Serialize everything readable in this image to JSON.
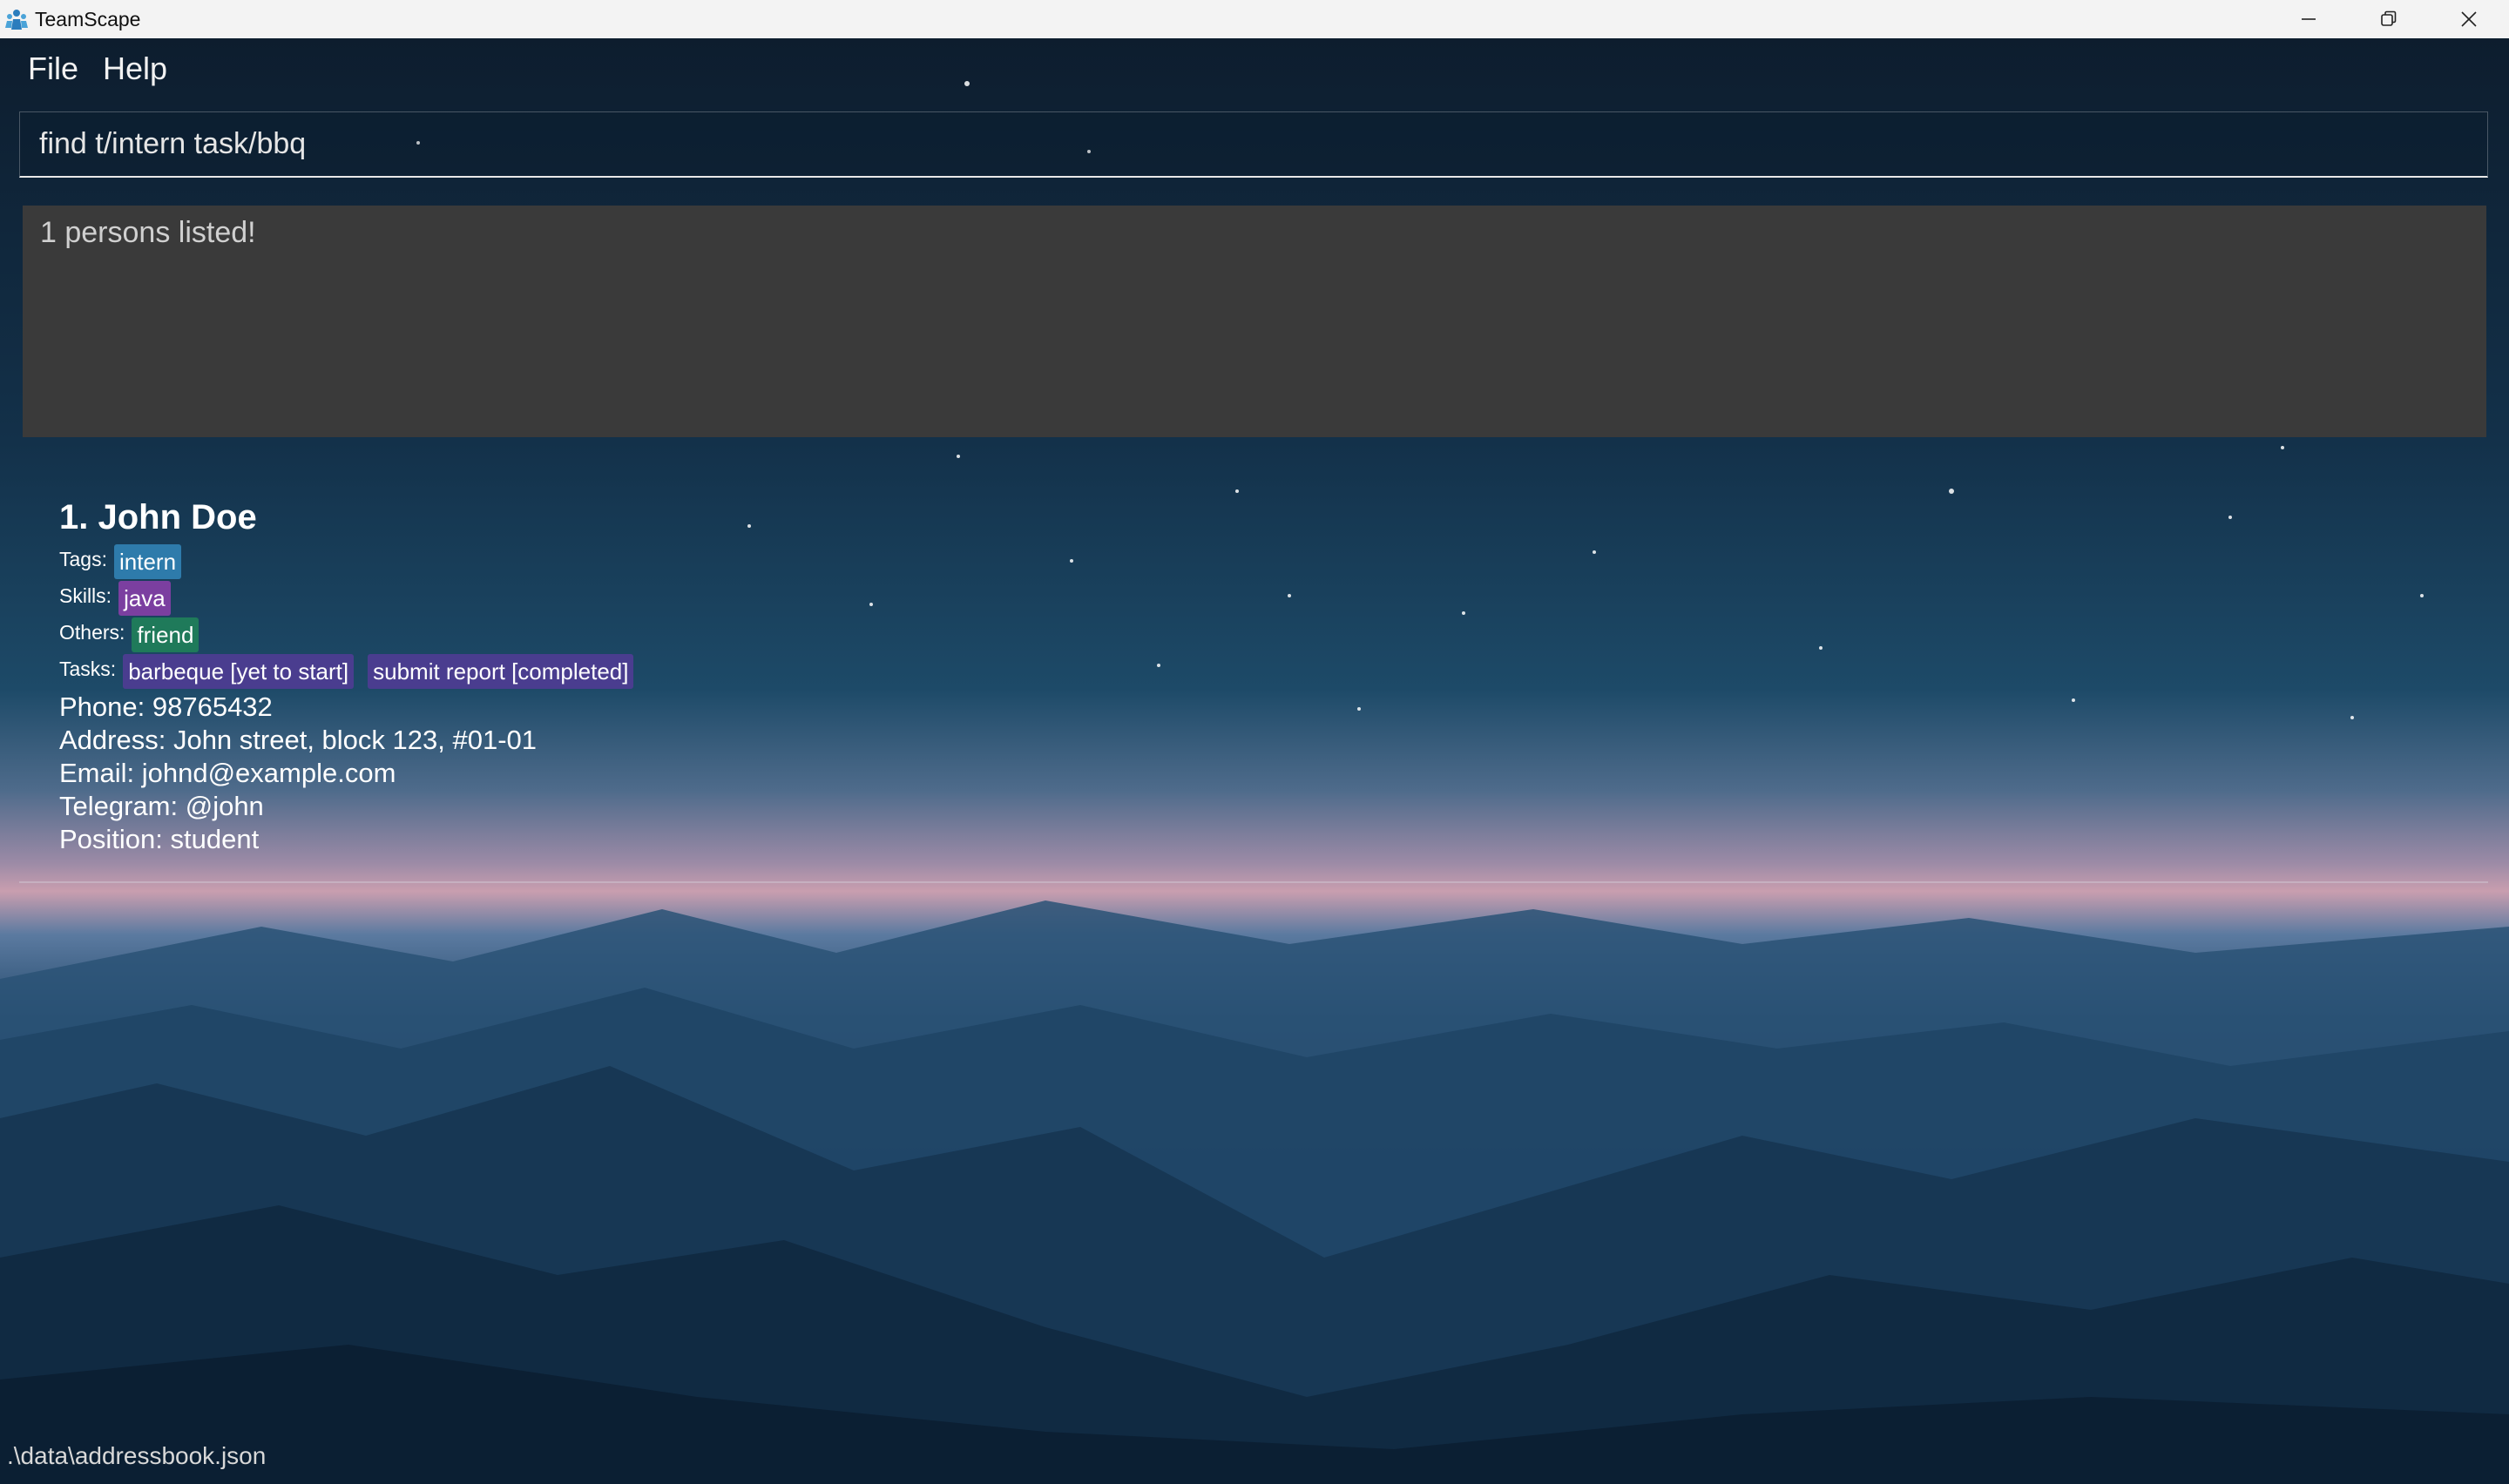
{
  "window": {
    "title": "TeamScape",
    "controls": [
      "minimize",
      "restore",
      "close"
    ]
  },
  "menu": {
    "items": [
      {
        "label": "File"
      },
      {
        "label": "Help"
      }
    ]
  },
  "command": {
    "value": "find t/intern task/bbq"
  },
  "result": {
    "text": "1 persons listed!"
  },
  "persons": [
    {
      "index_name": "1. John Doe",
      "tags_label": "Tags:",
      "tags": [
        "intern"
      ],
      "skills_label": "Skills:",
      "skills": [
        "java"
      ],
      "others_label": "Others:",
      "others": [
        "friend"
      ],
      "tasks_label": "Tasks:",
      "tasks": [
        "barbeque [yet to start]",
        "submit report [completed]"
      ],
      "phone": "Phone: 98765432",
      "address": "Address: John street, block 123, #01-01",
      "email": "Email: johnd@example.com",
      "telegram": "Telegram: @john",
      "position": "Position: student"
    }
  ],
  "status": {
    "path": ".\\data\\addressbook.json"
  },
  "colors": {
    "tag": "#2e7bab",
    "skill": "#7b3fa0",
    "other": "#1f7a5a",
    "task": "#4a3d8f",
    "result_bg": "#3a3a3a",
    "titlebar_bg": "#f3f3f3"
  }
}
